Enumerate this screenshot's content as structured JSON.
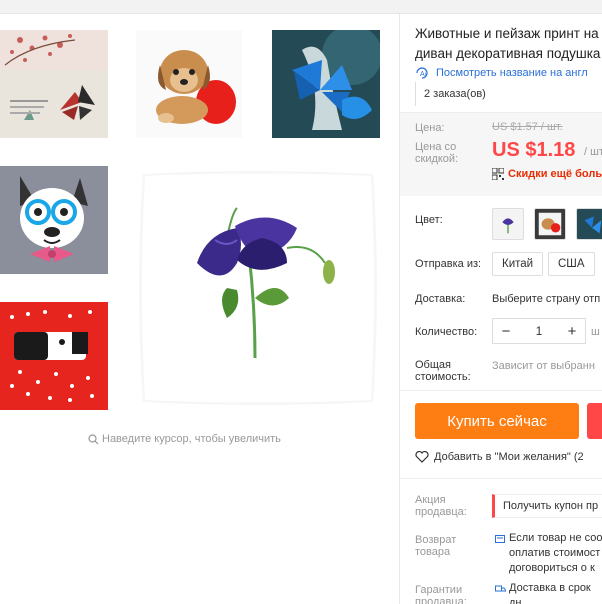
{
  "gallery": {
    "zoom_hint": "Наведите курсор, чтобы увеличить"
  },
  "product": {
    "title_line1": "Животные и пейзаж принт на",
    "title_line2": "диван декоративная подушка",
    "translate_link": "Посмотреть название на англ",
    "orders": "2 заказа(ов)"
  },
  "price": {
    "price_label": "Цена:",
    "old_price": "US $1.57 / шт.",
    "discount_label_line1": "Цена со",
    "discount_label_line2": "скидкой:",
    "new_price": "US $1.18",
    "per_unit": "/ шт",
    "promo": "Скидки ещё больш"
  },
  "options": {
    "color_label": "Цвет:",
    "ship_from_label": "Отправка из:",
    "ship_from_options": [
      "Китай",
      "США"
    ],
    "delivery_label": "Доставка:",
    "delivery_value": "Выберите страну отп",
    "quantity_label": "Количество:",
    "quantity_value": "1",
    "quantity_unit": "ш",
    "total_label_line1": "Общая",
    "total_label_line2": "стоимость:",
    "total_value": "Зависит от выбранн"
  },
  "actions": {
    "buy_now": "Купить сейчас",
    "wishlist": "Добавить в \"Мои желания\" (2"
  },
  "seller": {
    "promo_label_line1": "Акция",
    "promo_label_line2": "продавца:",
    "coupon": "Получить купон пр",
    "return_label_line1": "Возврат",
    "return_label_line2": "товара",
    "return_line1": "Если товар не соо",
    "return_line2": "оплатив стоимост",
    "return_line3": "договориться о к",
    "guarantee_label_line1": "Гарантии",
    "guarantee_label_line2": "продавца:",
    "guarantee_value": "Доставка в срок",
    "guarantee_value_line2": "дн"
  },
  "colors": {
    "accent_orange": "#ff7e14",
    "accent_red": "#ff4747",
    "link_blue": "#2a6fd8"
  }
}
